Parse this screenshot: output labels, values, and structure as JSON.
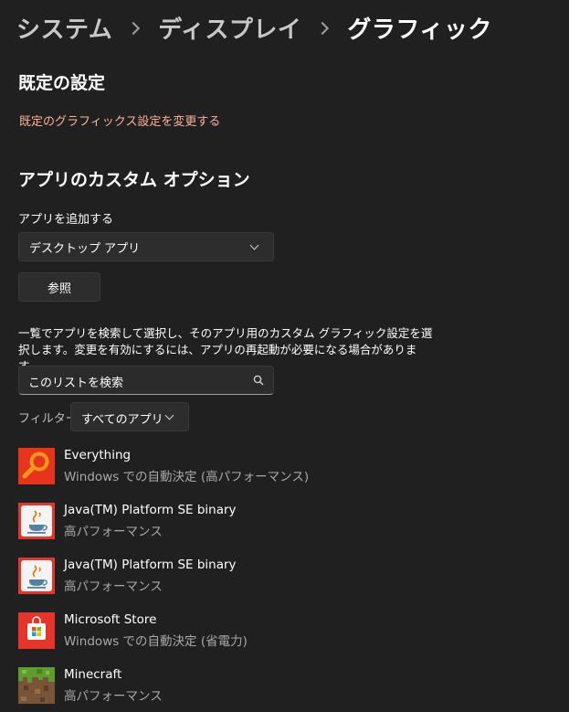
{
  "breadcrumb": {
    "items": [
      "システム",
      "ディスプレイ",
      "グラフィック"
    ]
  },
  "defaults": {
    "heading": "既定の設定",
    "link": "既定のグラフィックス設定を変更する"
  },
  "custom_options": {
    "heading": "アプリのカスタム オプション",
    "add_app_label": "アプリを追加する",
    "app_type_value": "デスクトップ アプリ",
    "browse_button": "参照",
    "description": "一覧でアプリを検索して選択し、そのアプリ用のカスタム グラフィック設定を選択します。変更を有効にするには、アプリの再起動が必要になる場合があります。"
  },
  "search": {
    "placeholder": "このリストを検索"
  },
  "filter": {
    "label": "フィルター:",
    "value": "すべてのアプリ"
  },
  "apps": [
    {
      "name": "Everything",
      "setting": "Windows での自動決定 (高パフォーマンス)",
      "icon": "everything-icon"
    },
    {
      "name": "Java(TM) Platform SE binary",
      "setting": "高パフォーマンス",
      "icon": "java-icon"
    },
    {
      "name": "Java(TM) Platform SE binary",
      "setting": "高パフォーマンス",
      "icon": "java-icon"
    },
    {
      "name": "Microsoft Store",
      "setting": "Windows での自動決定 (省電力)",
      "icon": "microsoft-store-icon"
    },
    {
      "name": "Minecraft",
      "setting": "高パフォーマンス",
      "icon": "minecraft-icon"
    }
  ],
  "colors": {
    "background": "#202020",
    "link": "#ffb098",
    "control": "#2d2d2d",
    "secondary_text": "#a8a8a8"
  }
}
